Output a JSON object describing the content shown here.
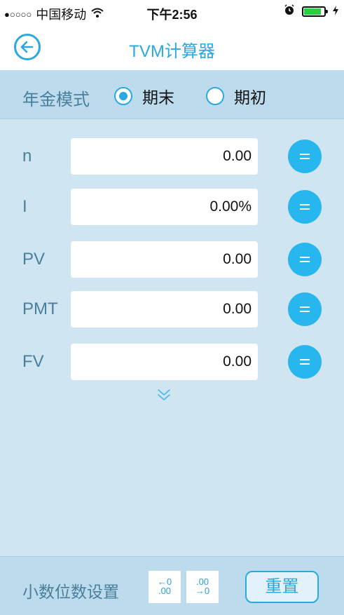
{
  "status_bar": {
    "signal": "●○○○○",
    "carrier": "中国移动",
    "time": "下午2:56"
  },
  "navbar": {
    "title": "TVM计算器"
  },
  "mode": {
    "label": "年金模式",
    "options": [
      {
        "label": "期末",
        "selected": true
      },
      {
        "label": "期初",
        "selected": false
      }
    ]
  },
  "fields": [
    {
      "label": "n",
      "value": "0.00"
    },
    {
      "label": "I",
      "value": "0.00%"
    },
    {
      "label": "PV",
      "value": "0.00"
    },
    {
      "label": "PMT",
      "value": "0.00"
    },
    {
      "label": "FV",
      "value": "0.00"
    }
  ],
  "footer": {
    "decimal_label": "小数位数设置",
    "dec_left": {
      "top": "←0",
      "bottom": ".00"
    },
    "dec_right": {
      "top": ".00",
      "bottom": "→0"
    },
    "reset_label": "重置"
  },
  "colors": {
    "accent": "#29a9df",
    "button": "#27b6ee",
    "label": "#4a7e9b",
    "background": "#cfe6f2",
    "bar": "#bcdcee"
  },
  "icons": {
    "back": "back-arrow-icon",
    "expand": "double-chevron-down-icon",
    "equals": "equals-icon"
  }
}
